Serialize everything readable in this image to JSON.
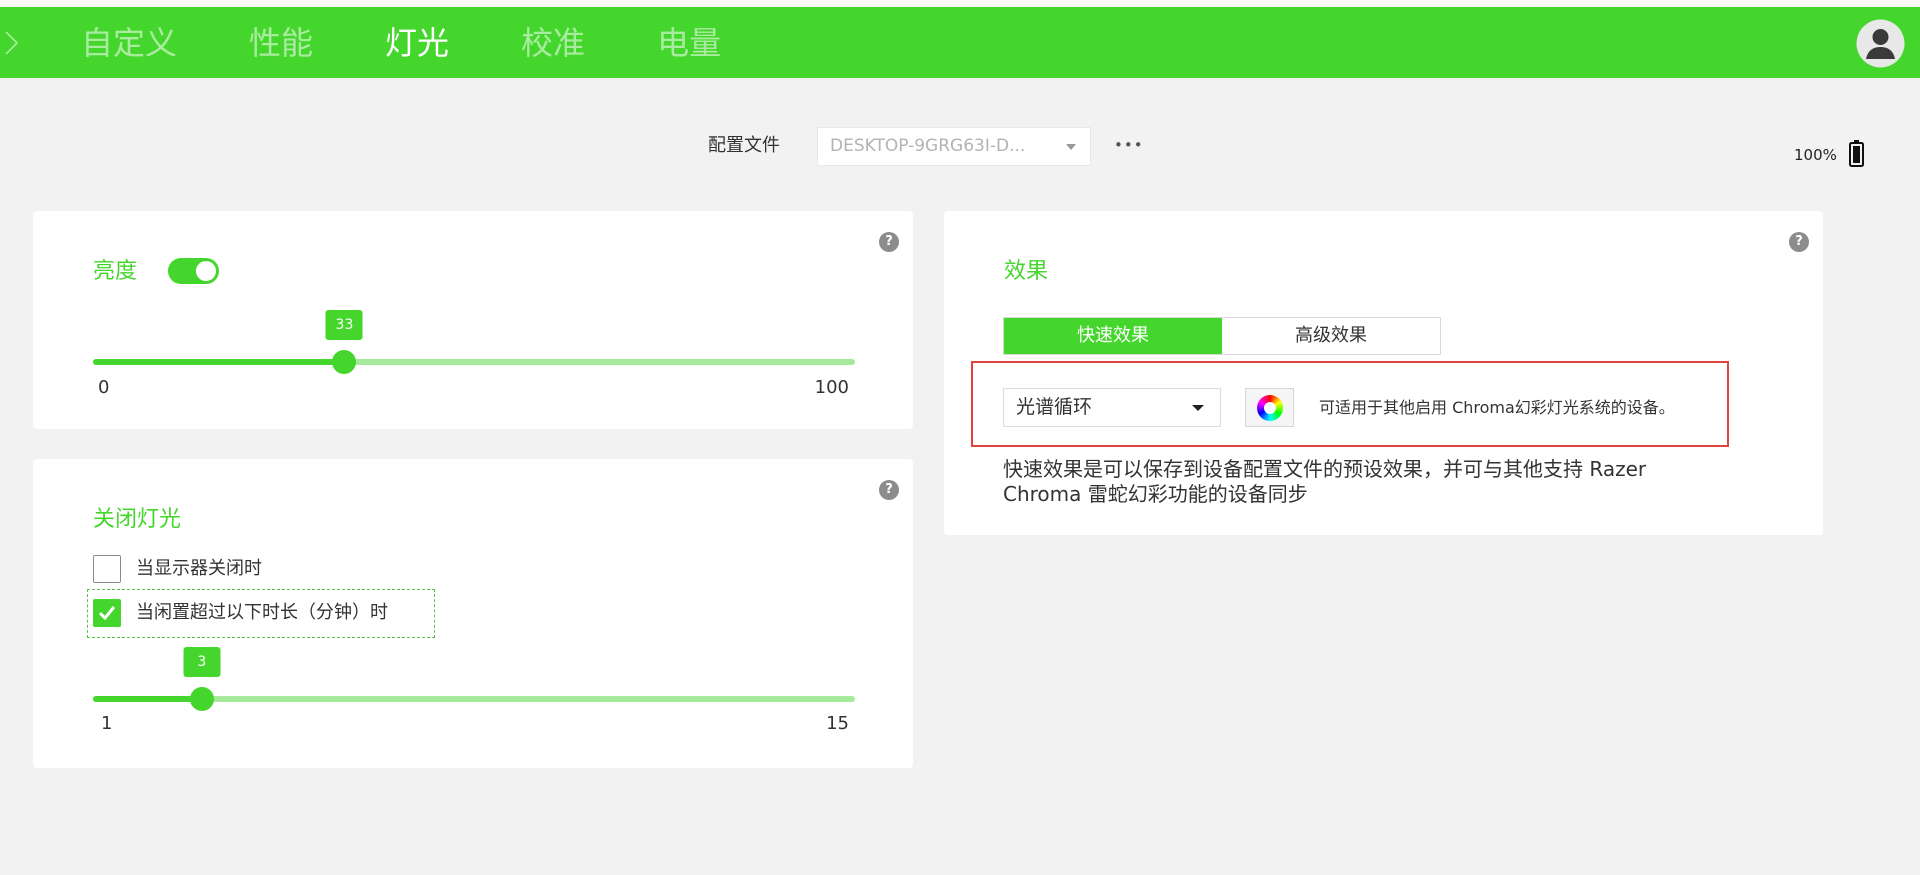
{
  "nav": {
    "back_icon": "chevron-right-icon",
    "tabs": [
      {
        "label": "自定义",
        "active": false
      },
      {
        "label": "性能",
        "active": false
      },
      {
        "label": "灯光",
        "active": true
      },
      {
        "label": "校准",
        "active": false
      },
      {
        "label": "电量",
        "active": false
      }
    ],
    "avatar_icon": "user-avatar-icon"
  },
  "profile": {
    "label": "配置文件",
    "selected": "DESKTOP-9GRG63I-D...",
    "more": "•••"
  },
  "battery": {
    "text": "100%",
    "level": 100,
    "icon": "battery-icon"
  },
  "help_glyph": "?",
  "brightness": {
    "title": "亮度",
    "enabled": true,
    "value": 33,
    "min": 0,
    "max": 100
  },
  "lights_off": {
    "title": "关闭灯光",
    "display_off": {
      "label": "当显示器关闭时",
      "checked": false
    },
    "idle": {
      "label": "当闲置超过以下时长（分钟）时",
      "checked": true
    },
    "value": 3,
    "min": 1,
    "max": 15
  },
  "effects": {
    "title": "效果",
    "tabs": [
      {
        "label": "快速效果",
        "active": true
      },
      {
        "label": "高级效果",
        "active": false
      }
    ],
    "selected_effect": "光谱循环",
    "color_icon": "color-wheel-icon",
    "chroma_note": "可适用于其他启用 Chroma幻彩灯光系统的设备。",
    "description": "快速效果是可以保存到设备配置文件的预设效果，并可与其他支持 Razer Chroma 雷蛇幻彩功能的设备同步"
  },
  "colors": {
    "accent": "#44d62c",
    "track": "#a7e99c",
    "highlight_border": "#e0453b",
    "background": "#f2f2f2"
  }
}
